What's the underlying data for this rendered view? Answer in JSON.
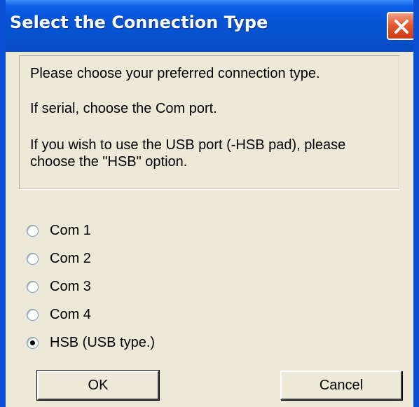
{
  "dialog": {
    "title": "Select the Connection Type",
    "close_icon": "close-icon"
  },
  "info": {
    "line1": "Please choose your preferred connection type.",
    "line2": "If serial, choose the Com port.",
    "line3a": "If you wish to use the USB port (-HSB pad), please",
    "line3b": "choose the \"HSB\" option."
  },
  "options": [
    {
      "label": "Com 1",
      "selected": false
    },
    {
      "label": "Com 2",
      "selected": false
    },
    {
      "label": "Com 3",
      "selected": false
    },
    {
      "label": "Com 4",
      "selected": false
    },
    {
      "label": "HSB (USB type.)",
      "selected": true
    }
  ],
  "buttons": {
    "ok_label": "OK",
    "cancel_label": "Cancel"
  },
  "colors": {
    "title_bar": "#0654d6",
    "dialog_bg": "#ece9d8",
    "close_button": "#e45a30"
  }
}
